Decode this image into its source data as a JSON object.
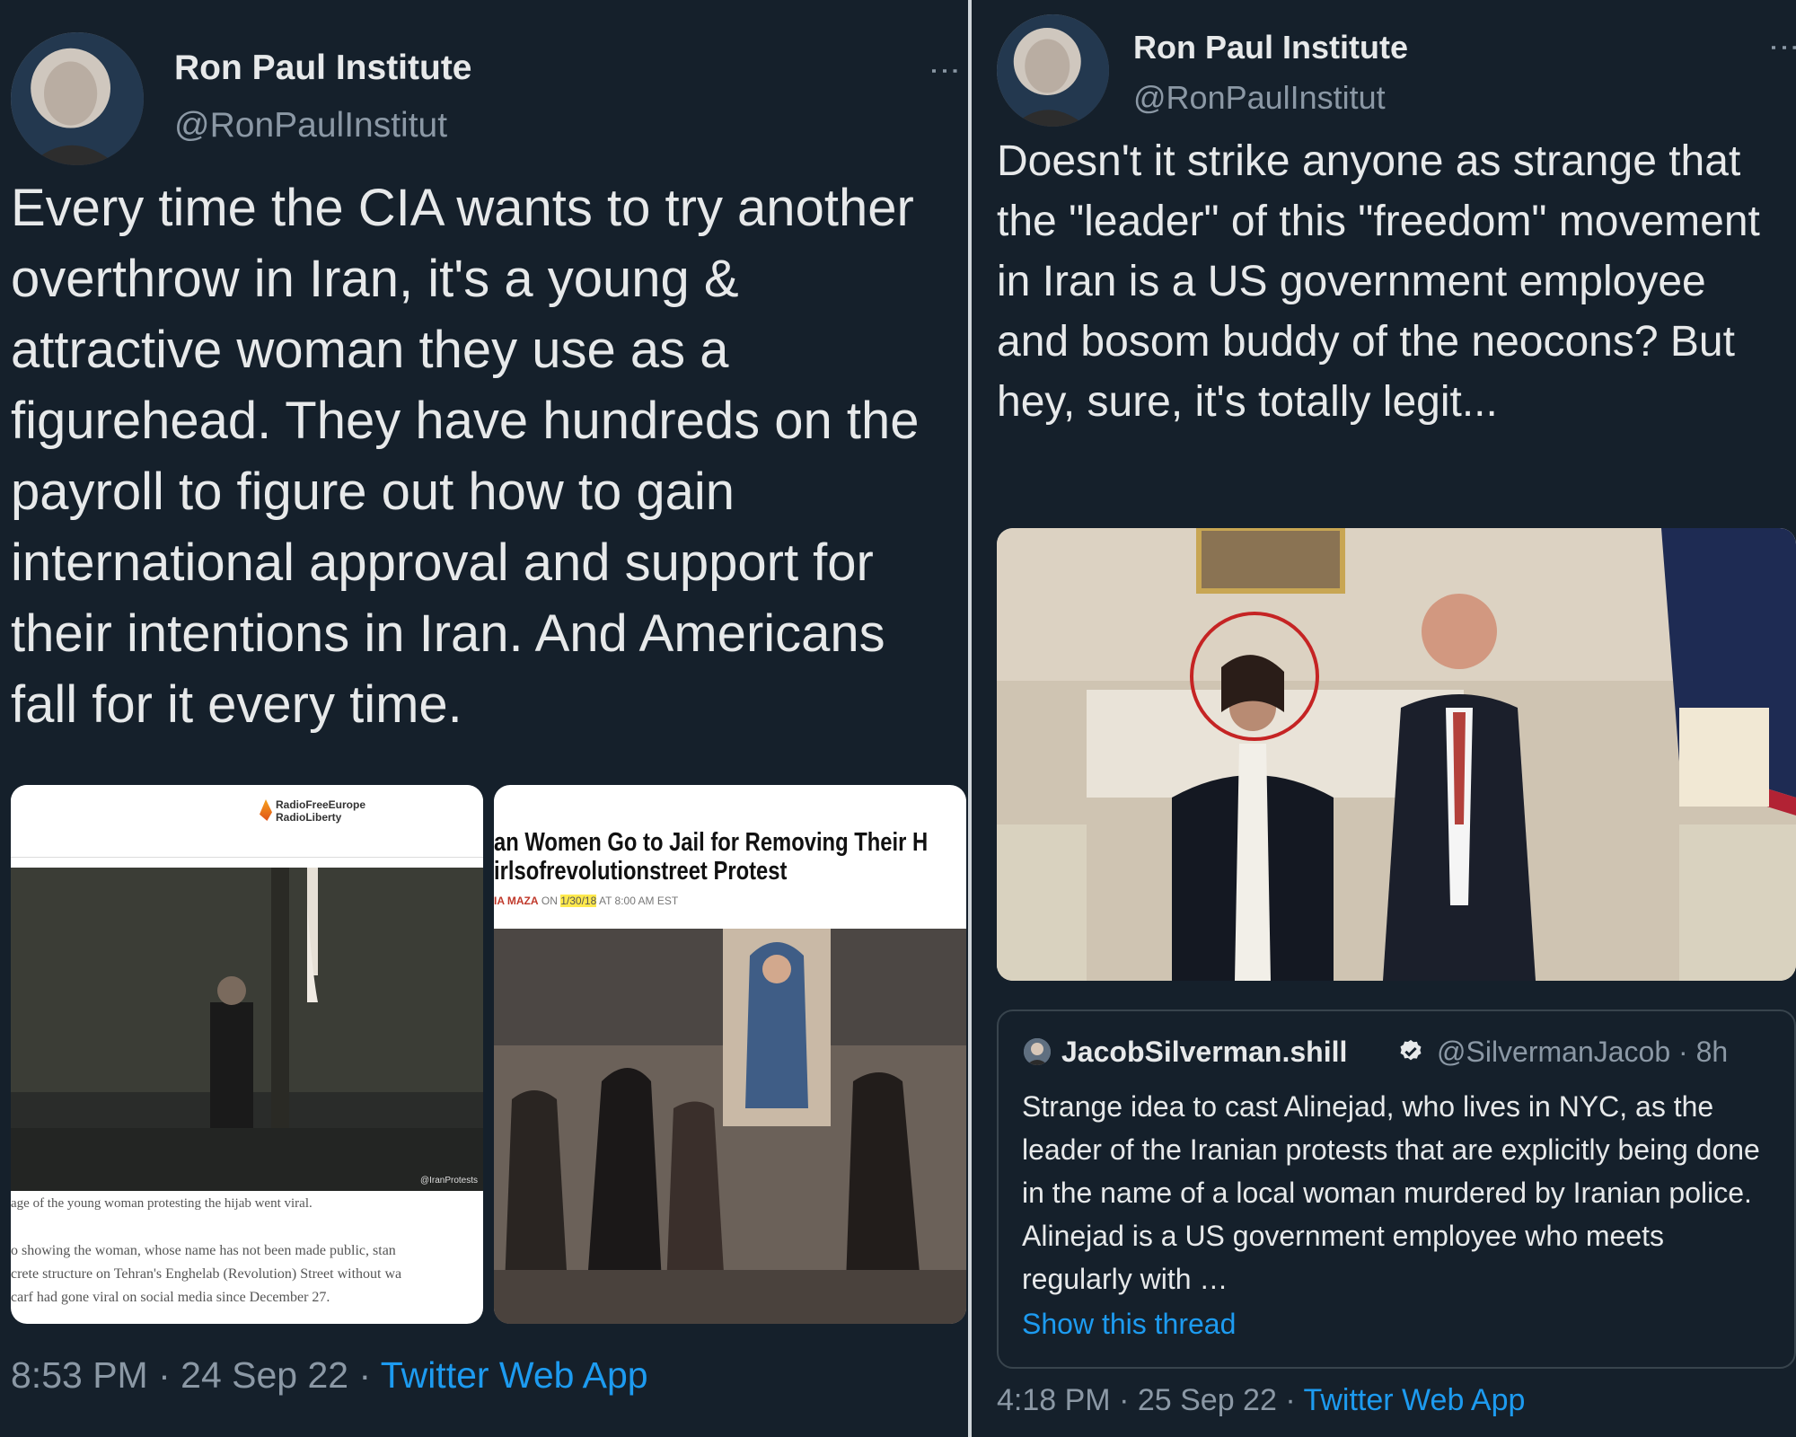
{
  "left_tweet": {
    "author_name": "Ron Paul Institute",
    "author_handle": "@RonPaulInstitut",
    "text": "Every time the CIA wants to try another overthrow in Iran, it's a young & attractive woman they use as a figurehead. They have hundreds on the payroll to figure out how to gain international approval and support for their intentions in Iran. And Americans fall for it every time.",
    "time": "8:53 PM",
    "date": "24 Sep 22",
    "app": "Twitter Web App",
    "media": [
      {
        "logo_line1": "RadioFreeEurope",
        "logo_line2": "RadioLiberty",
        "watermark": "@IranProtests",
        "caption1": "age of the young woman protesting the hijab went viral.",
        "caption2": "o showing the woman, whose name has not been made public, stan",
        "caption3": "crete structure on Tehran's Enghelab (Revolution) Street without wa",
        "caption4": "carf had gone viral on social media since December 27."
      },
      {
        "headline1": "an Women Go to Jail for Removing Their H",
        "headline2": "irlsofrevolutionstreet Protest",
        "author": "IA MAZA",
        "on": "ON",
        "date": "1/30/18",
        "time": "AT 8:00 AM EST"
      }
    ]
  },
  "right_tweet": {
    "author_name": "Ron Paul Institute",
    "author_handle": "@RonPaulInstitut",
    "text": "Doesn't it strike anyone as strange that the \"leader\" of this \"freedom\" movement in Iran is a US government employee and bosom buddy of the neocons? But hey, sure, it's totally legit...",
    "time": "4:18 PM",
    "date": "25 Sep 22",
    "app": "Twitter Web App",
    "quoted": {
      "author_name": "JacobSilverman.shill",
      "author_handle": "@SilvermanJacob",
      "age": "8h",
      "text": "Strange idea to cast Alinejad, who lives in NYC, as the leader of the Iranian protests that are explicitly being done in the name of a local woman murdered by Iranian police. Alinejad is a US government employee who meets regularly with …",
      "show_thread": "Show this thread"
    }
  },
  "colors": {
    "background": "#15202b",
    "text": "#e7e9ea",
    "secondary": "#8b98a5",
    "link": "#1d9bf0"
  }
}
